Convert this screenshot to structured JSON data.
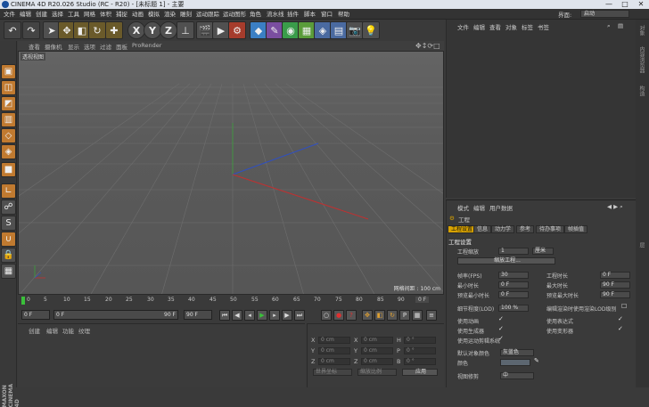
{
  "window": {
    "title": "CINEMA 4D R20.026 Studio (RC - R20) - [未标题 1] - 主要",
    "min": "—",
    "max": "□",
    "close": "✕"
  },
  "menubar": {
    "items": [
      "文件",
      "编辑",
      "创建",
      "选择",
      "工具",
      "网格",
      "体积",
      "捕捉",
      "动画",
      "模拟",
      "渲染",
      "雕刻",
      "运动跟踪",
      "运动图形",
      "角色",
      "流水线",
      "插件",
      "脚本",
      "窗口",
      "帮助"
    ],
    "layout_label": "界面:",
    "layout_value": "启动"
  },
  "toolbar": {
    "buttons": [
      "undo",
      "redo",
      "select-arrow",
      "move",
      "scale",
      "rotate",
      "last-tool",
      "X",
      "Y",
      "Z",
      "coord",
      "render-view",
      "render",
      "render-settings",
      "cube",
      "pen",
      "subdivision",
      "array",
      "deformer",
      "floor",
      "camera",
      "light"
    ]
  },
  "viewport": {
    "menu": [
      "查看",
      "摄像机",
      "显示",
      "选项",
      "过滤",
      "面板",
      "ProRender"
    ],
    "label": "透视视图",
    "grid_info": "网格间距 : 100 cm"
  },
  "timeline": {
    "ticks": [
      "0",
      "5",
      "10",
      "15",
      "20",
      "25",
      "30",
      "35",
      "40",
      "45",
      "50",
      "55",
      "60",
      "65",
      "70",
      "75",
      "80",
      "85",
      "90"
    ],
    "end": "0 F"
  },
  "playbar": {
    "current": "0 F",
    "start": "0 F",
    "end_a": "90 F",
    "end_b": "90 F"
  },
  "materials": {
    "menu": [
      "创建",
      "编辑",
      "功能",
      "纹理"
    ]
  },
  "coordinates": {
    "labels": [
      "X",
      "Y",
      "Z"
    ],
    "pos": [
      "0 cm",
      "0 cm",
      "0 cm"
    ],
    "size": [
      "0 cm",
      "0 cm",
      "0 cm"
    ],
    "rot_labels": [
      "H",
      "P",
      "B"
    ],
    "rot": [
      "0 °",
      "0 °",
      "0 °"
    ],
    "mode_a": "世界坐标",
    "mode_b": "缩放比例",
    "apply": "应用"
  },
  "objects": {
    "menu": [
      "文件",
      "编辑",
      "查看",
      "对象",
      "标签",
      "书签"
    ]
  },
  "attributes": {
    "menu": [
      "模式",
      "编辑",
      "用户数据"
    ],
    "section": "工程",
    "tabs": [
      "工程设置",
      "信息",
      "动力学",
      "参考",
      "待办事项",
      "帧插值"
    ],
    "heading": "工程设置",
    "scale_label": "工程缩放",
    "scale_value": "1",
    "scale_unit": "厘米",
    "scale_button": "缩放工程...",
    "left": [
      {
        "label": "帧率(FPS)",
        "value": "30"
      },
      {
        "label": "最小时长",
        "value": "0 F"
      },
      {
        "label": "预览最小时长",
        "value": "0 F"
      },
      {
        "label": "细节程度(LOD)",
        "value": "100 %"
      }
    ],
    "right": [
      {
        "label": "工程时长",
        "value": "0 F"
      },
      {
        "label": "最大时长",
        "value": "90 F"
      },
      {
        "label": "预览最大时长",
        "value": "90 F"
      }
    ],
    "lod_render": "编辑渲染时使用渲染LOD级别",
    "checks_left": [
      "使用动画",
      "使用生成器",
      "使用运动剪辑系统"
    ],
    "checks_right": [
      "使用表达式",
      "使用变形器"
    ],
    "default_color_label": "默认对象颜色",
    "default_color_value": "灰蓝色",
    "color_label": "颜色",
    "view_label": "视图修剪",
    "view_value": "中"
  },
  "right_strip": [
    "对象",
    "内容浏览器",
    "构造",
    "层"
  ],
  "logo": "MAXON CINEMA 4D"
}
